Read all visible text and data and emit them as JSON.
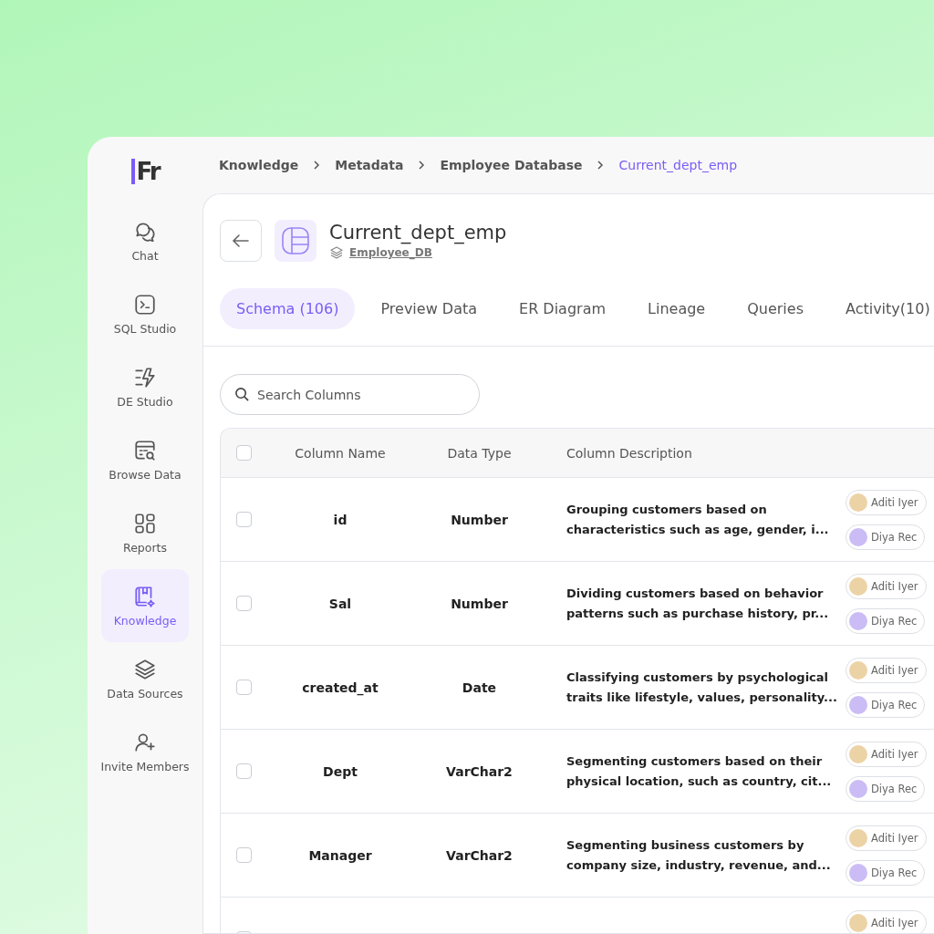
{
  "logo": {
    "text": "Fr"
  },
  "sidebar": {
    "items": [
      {
        "kind": "chat",
        "label": "Chat",
        "selected": false
      },
      {
        "kind": "terminal",
        "label": "SQL Studio",
        "selected": false
      },
      {
        "kind": "bolt",
        "label": "DE Studio",
        "selected": false
      },
      {
        "kind": "browse",
        "label": "Browse Data",
        "selected": false
      },
      {
        "kind": "grid",
        "label": "Reports",
        "selected": false
      },
      {
        "kind": "book",
        "label": "Knowledge",
        "selected": true
      },
      {
        "kind": "layers",
        "label": "Data Sources",
        "selected": false
      },
      {
        "kind": "user-plus",
        "label": "Invite Members",
        "selected": false
      }
    ]
  },
  "breadcrumb": [
    {
      "label": "Knowledge",
      "selected": false
    },
    {
      "label": "Metadata",
      "selected": false
    },
    {
      "label": "Employee Database",
      "selected": false
    },
    {
      "label": "Current_dept_emp",
      "selected": true
    }
  ],
  "header": {
    "title": "Current_dept_emp",
    "database": "Employee_DB"
  },
  "tabs": [
    {
      "label": "Schema (106)",
      "selected": true
    },
    {
      "label": "Preview Data",
      "selected": false
    },
    {
      "label": "ER Diagram",
      "selected": false
    },
    {
      "label": "Lineage",
      "selected": false
    },
    {
      "label": "Queries",
      "selected": false
    },
    {
      "label": "Activity(10)",
      "selected": false
    }
  ],
  "search": {
    "placeholder": "Search Columns"
  },
  "table": {
    "header_checked": false,
    "columns": [
      "Column Name",
      "Data Type",
      "Column Description"
    ],
    "rows": [
      {
        "name": "id",
        "type": "Number",
        "description": [
          "Grouping customers based on",
          "characteristics such as age, gender, i..."
        ],
        "checked": false,
        "owners": [
          {
            "name": "Aditi Iyer",
            "color": "#ecd3a6"
          },
          {
            "name": "Diya Rec",
            "color": "#cbbcf5"
          }
        ]
      },
      {
        "name": "Sal",
        "type": "Number",
        "description": [
          "Dividing customers based on behavior",
          "patterns such as purchase history, pr..."
        ],
        "checked": false,
        "owners": [
          {
            "name": "Aditi Iyer",
            "color": "#ecd3a6"
          },
          {
            "name": "Diya Rec",
            "color": "#cbbcf5"
          }
        ]
      },
      {
        "name": "created_at",
        "type": "Date",
        "description": [
          "Classifying customers by psychological",
          "traits like lifestyle, values, personality..."
        ],
        "checked": false,
        "owners": [
          {
            "name": "Aditi Iyer",
            "color": "#ecd3a6"
          },
          {
            "name": "Diya Rec",
            "color": "#cbbcf5"
          }
        ]
      },
      {
        "name": "Dept",
        "type": "VarChar2",
        "description": [
          "Segmenting customers based on their",
          "physical location, such as country, cit..."
        ],
        "checked": false,
        "owners": [
          {
            "name": "Aditi Iyer",
            "color": "#ecd3a6"
          },
          {
            "name": "Diya Rec",
            "color": "#cbbcf5"
          }
        ]
      },
      {
        "name": "Manager",
        "type": "VarChar2",
        "description": [
          "Segmenting business customers by",
          "company size, industry, revenue, and..."
        ],
        "checked": false,
        "owners": [
          {
            "name": "Aditi Iyer",
            "color": "#ecd3a6"
          },
          {
            "name": "Diya Rec",
            "color": "#cbbcf5"
          }
        ]
      },
      {
        "checked": false,
        "owners": [
          {
            "name": "Aditi Iyer",
            "color": "#ecd3a6"
          }
        ]
      }
    ]
  }
}
